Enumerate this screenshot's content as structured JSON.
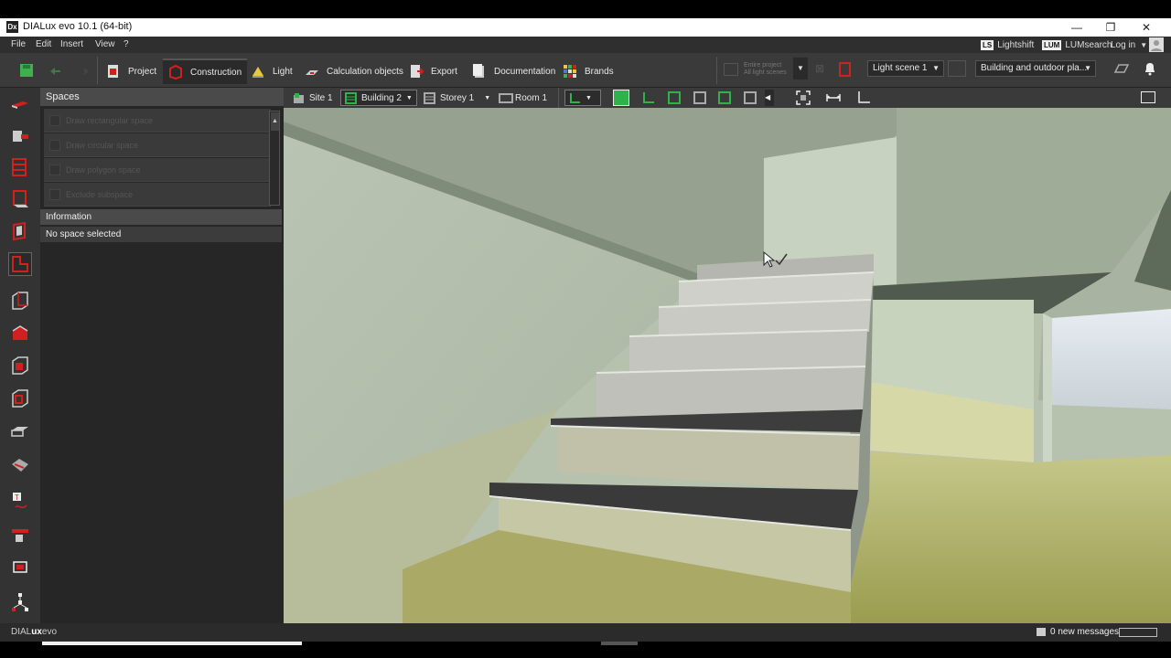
{
  "window": {
    "title": "DIALux evo 10.1  (64-bit)",
    "logo": "Dx",
    "minimize": "—",
    "restore": "❐",
    "close": "✕"
  },
  "menu": {
    "items": [
      "File",
      "Edit",
      "Insert",
      "View",
      "?"
    ],
    "lightshift_badge": "LS",
    "lightshift": "Lightshift",
    "lumsearch_badge": "LUM",
    "lumsearch": "LUMsearch",
    "login": "Log in"
  },
  "toolbar": {
    "tabs": [
      "Project",
      "Construction",
      "Light",
      "Calculation objects",
      "Export",
      "Documentation",
      "Brands"
    ],
    "active_tab": "Construction",
    "entire_project_line1": "Entire project",
    "entire_project_line2": "All light scenes",
    "light_scene": "Light scene 1",
    "view_mode": "Building and outdoor pla...",
    "accent_red": "#d02020",
    "accent_green": "#2db34a"
  },
  "panel": {
    "title": "Spaces",
    "tools": [
      "Draw rectangular space",
      "Draw circular space",
      "Draw polygon space",
      "Exclude subspace"
    ],
    "info_title": "Information",
    "info_value": "No space selected"
  },
  "viewbar": {
    "site": "Site 1",
    "building": "Building 2",
    "storey": "Storey 1",
    "room": "Room 1"
  },
  "status": {
    "brand_prefix": "DIAL",
    "brand_bold": "ux",
    "brand_suffix": "evo",
    "messages": "0 new messages"
  }
}
